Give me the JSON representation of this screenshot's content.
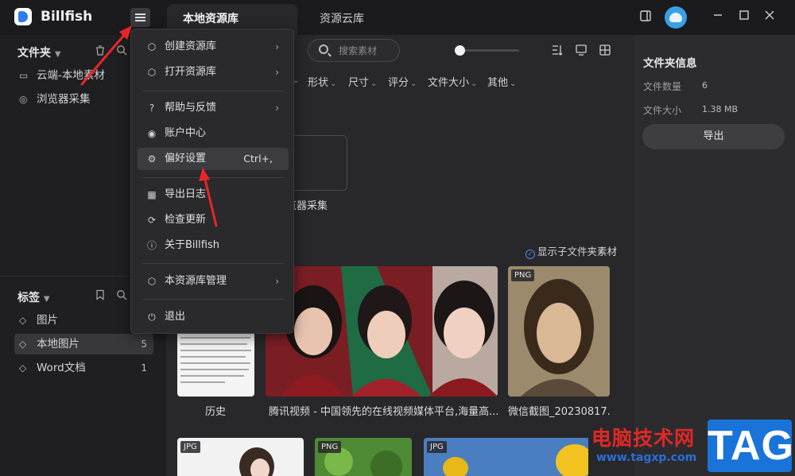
{
  "app": {
    "name": "Billfish"
  },
  "tabs": [
    {
      "label": "本地资源库"
    },
    {
      "label": "资源云库"
    }
  ],
  "sidebar": {
    "folders_title": "文件夹",
    "folders": [
      {
        "label": "云端-本地素材"
      },
      {
        "label": "浏览器采集"
      }
    ],
    "tags_title": "标签",
    "tags": [
      {
        "label": "图片",
        "count": ""
      },
      {
        "label": "本地图片",
        "count": "5"
      },
      {
        "label": "Word文档",
        "count": "1"
      }
    ]
  },
  "toolbar": {
    "search_placeholder": "搜索素材"
  },
  "filters": [
    "形状",
    "尺寸",
    "评分",
    "文件大小",
    "其他"
  ],
  "folder_card": {
    "label": "览器采集"
  },
  "show_subfolder": "显示子文件夹素材",
  "thumbnails_row1": [
    {
      "caption": "历史",
      "badge": ""
    },
    {
      "caption": "腾讯视频 - 中国领先的在线视频媒体平台,海量高...",
      "badge": ""
    },
    {
      "caption": "微信截图_20230817...",
      "badge": "PNG"
    }
  ],
  "thumbnails_row2": [
    {
      "badge": "JPG"
    },
    {
      "badge": "PNG"
    },
    {
      "badge": "JPG"
    }
  ],
  "right_panel": {
    "title": "文件夹信息",
    "rows": [
      {
        "key": "文件数量",
        "value": "6"
      },
      {
        "key": "文件大小",
        "value": "1.38 MB"
      }
    ],
    "export_label": "导出"
  },
  "menu": {
    "items": [
      {
        "label": "创建资源库",
        "icon": "cube-icon",
        "has_submenu": true
      },
      {
        "label": "打开资源库",
        "icon": "cube-icon",
        "has_submenu": true
      },
      {
        "label": "帮助与反馈",
        "icon": "help-icon",
        "has_submenu": true
      },
      {
        "label": "账户中心",
        "icon": "user-icon",
        "has_submenu": false
      },
      {
        "label": "偏好设置",
        "icon": "gear-icon",
        "shortcut": "Ctrl+,",
        "highlighted": true
      },
      {
        "label": "导出日志",
        "icon": "calendar-icon",
        "has_submenu": false
      },
      {
        "label": "检查更新",
        "icon": "update-icon",
        "has_submenu": false
      },
      {
        "label": "关于Billfish",
        "icon": "info-icon",
        "has_submenu": false
      },
      {
        "label": "本资源库管理",
        "icon": "cube-icon",
        "has_submenu": true
      },
      {
        "label": "退出",
        "icon": "exit-icon",
        "has_submenu": false
      }
    ]
  },
  "watermark": {
    "cn": "电脑技术网",
    "url": "www.tagxp.com",
    "tag": "TAG"
  },
  "colors": {
    "accent": "#2f7dea",
    "annotation_arrow": "#e8262a",
    "watermark_red": "#e02828",
    "watermark_blue": "#1a73d8"
  }
}
